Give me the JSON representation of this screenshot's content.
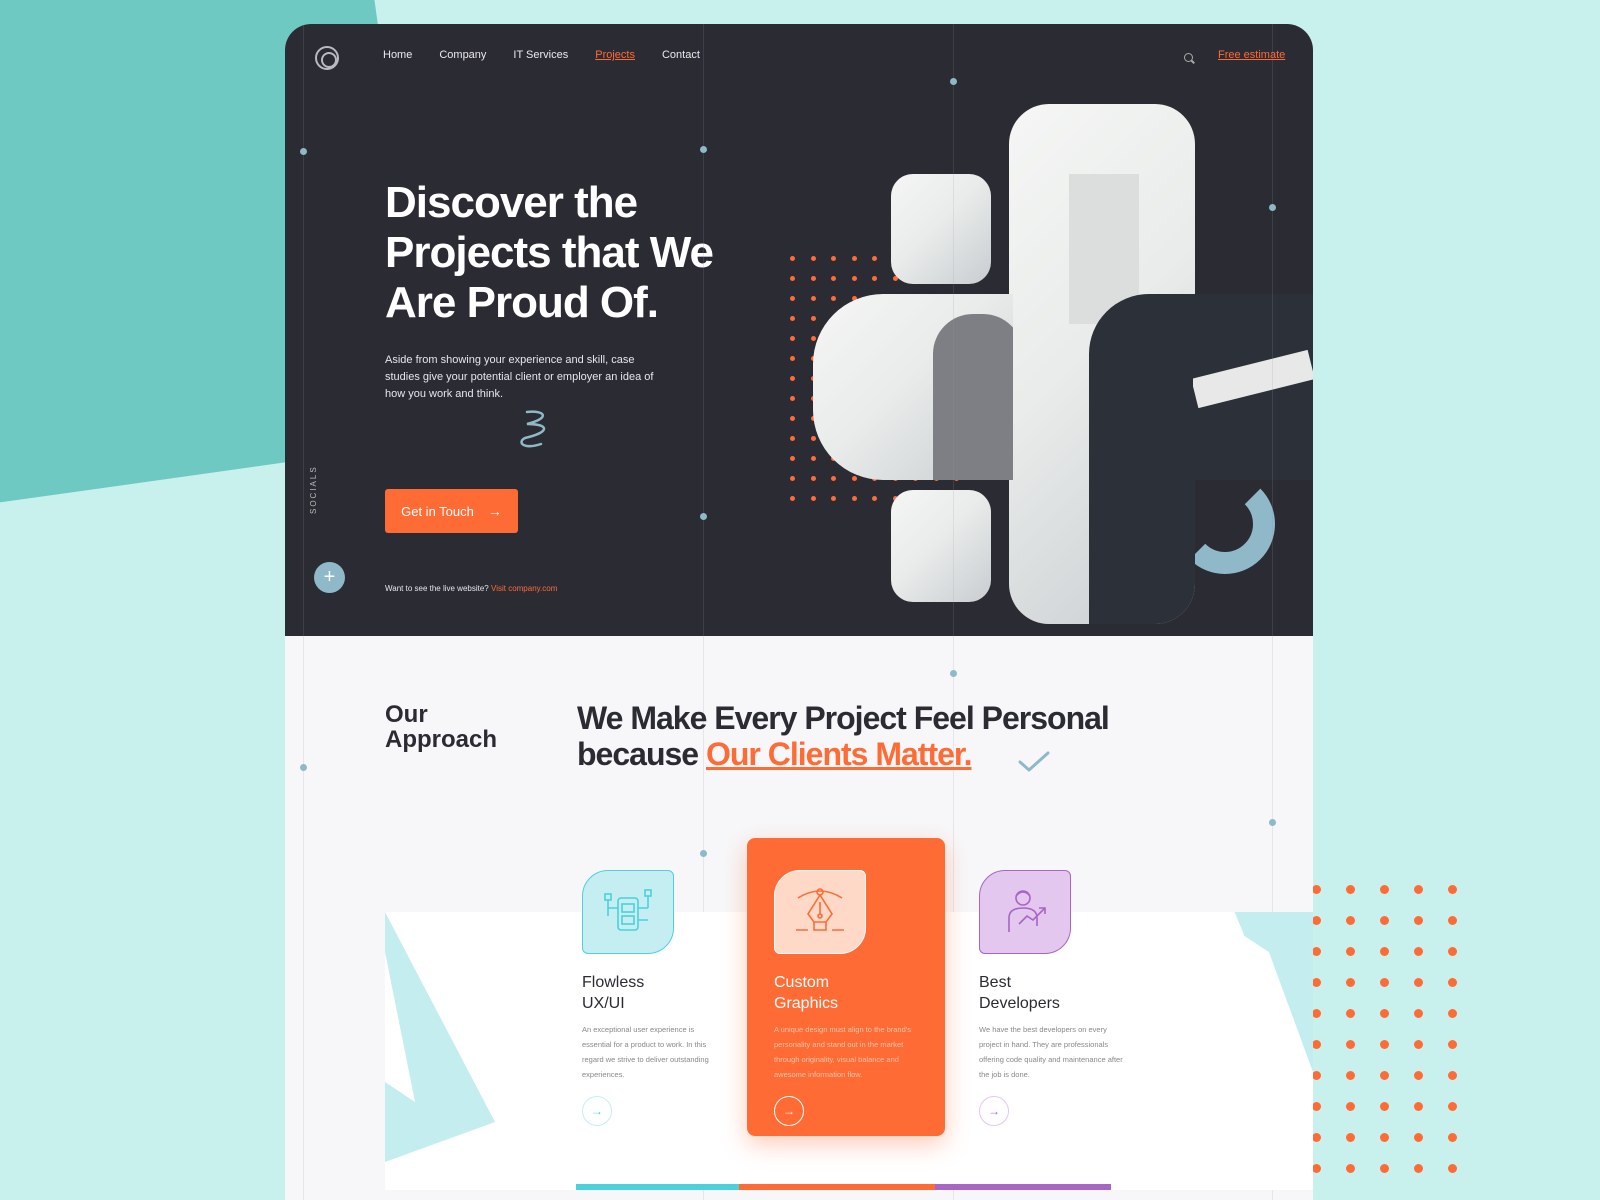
{
  "nav": {
    "items": [
      "Home",
      "Company",
      "IT Services",
      "Projects",
      "Contact"
    ],
    "active": "Projects",
    "estimate": "Free estimate"
  },
  "hero": {
    "title": "Discover the Projects that We Are Proud Of.",
    "description": "Aside from showing your experience and skill, case studies give your potential client or employer an idea of how you work and think.",
    "cta": "Get in Touch",
    "socials": "SOCIALS",
    "live_prefix": "Want to see the live website?",
    "live_link": "Visit company.com"
  },
  "approach": {
    "label": "Our Approach",
    "title_line1": "We Make Every Project Feel Personal",
    "title_prefix": "because",
    "title_highlight": "Our Clients Matter."
  },
  "cards": [
    {
      "title_1": "Flowless",
      "title_2": "UX/UI",
      "text": "An exceptional user experience is essential for a product to work. In this regard we strive to deliver outstanding experiences.",
      "color": "#4dd0d9",
      "icon": "wireframe-icon"
    },
    {
      "title_1": "Custom",
      "title_2": "Graphics",
      "text": "A unique design must align to the brand's personality and stand out in the market through originality, visual balance and awesome information flow.",
      "color": "#ff6b35",
      "icon": "pen-tool-icon"
    },
    {
      "title_1": "Best",
      "title_2": "Developers",
      "text": "We have the best developers on every project in hand. They are professionals offering code quality and maintenance after the job is done.",
      "color": "#a765c4",
      "icon": "developer-icon"
    }
  ],
  "colors": {
    "accent": "#ff6b35",
    "dark": "#2b2b33",
    "teal": "#6fc9c3",
    "blue_grey": "#8fb8c8"
  }
}
